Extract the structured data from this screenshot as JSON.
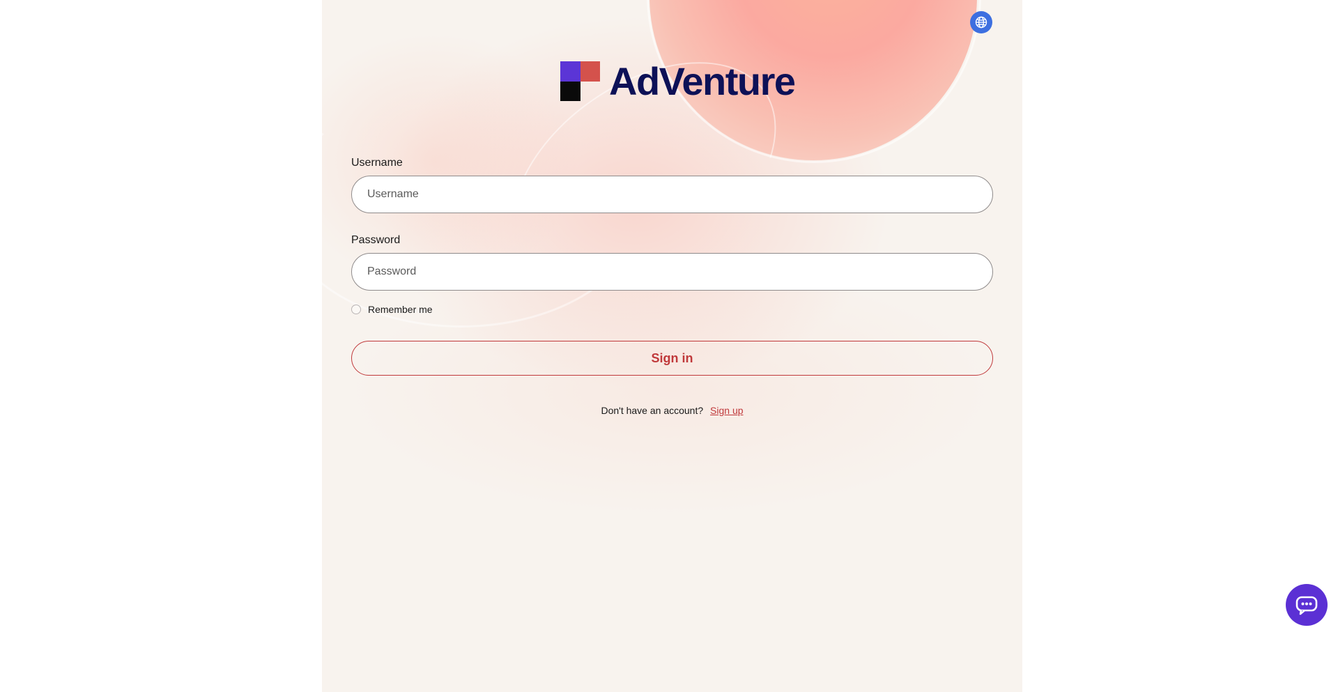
{
  "language_button": {
    "icon": "globe-icon"
  },
  "logo": {
    "text": "AdVenture",
    "colors": {
      "purple": "#5b35d6",
      "red": "#d4524c",
      "black": "#0a0a0a",
      "wordmark": "#0d1157"
    }
  },
  "form": {
    "username": {
      "label": "Username",
      "placeholder": "Username",
      "value": ""
    },
    "password": {
      "label": "Password",
      "placeholder": "Password",
      "value": ""
    },
    "remember_me": {
      "label": "Remember me",
      "checked": false
    },
    "sign_in_label": "Sign in"
  },
  "signup": {
    "prompt": "Don't have an account?",
    "link_label": "Sign up"
  },
  "chat_button": {
    "icon": "chat-bubble-icon"
  },
  "colors": {
    "accent": "#c0393b",
    "globe_button": "#3d6fe0",
    "chat_button": "#5b30d4",
    "panel_background": "#f8f3ee"
  }
}
